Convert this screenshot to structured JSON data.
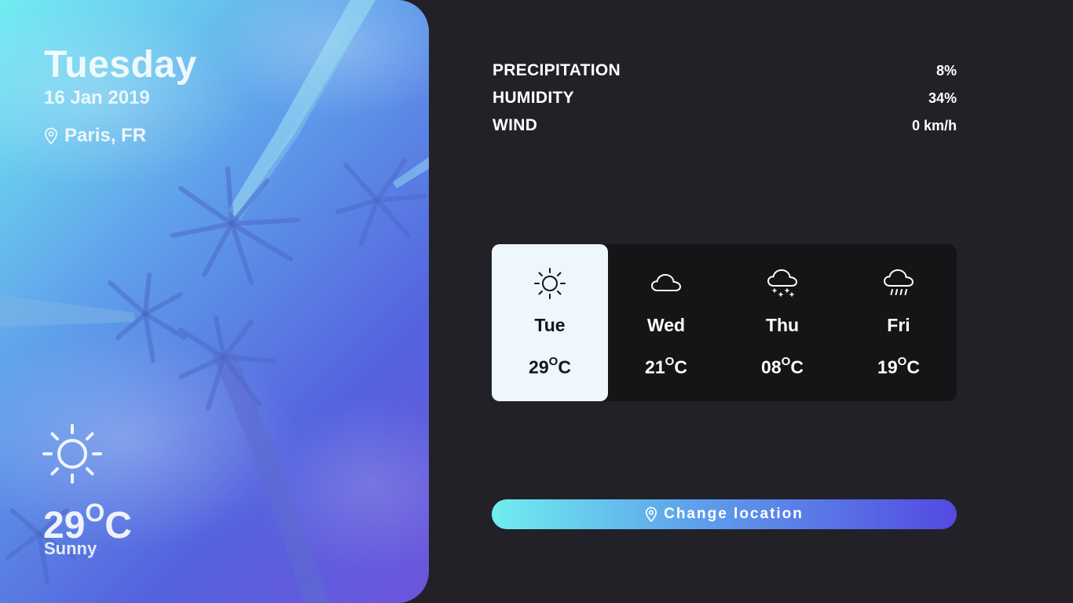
{
  "hero": {
    "day": "Tuesday",
    "date": "16 Jan 2019",
    "location": "Paris, FR",
    "temp_value": "29",
    "temp_degree": "O",
    "temp_unit": "C",
    "condition": "Sunny",
    "icon": "sun-icon",
    "location_icon": "map-pin-icon"
  },
  "stats": [
    {
      "label": "PRECIPITATION",
      "value": "8%"
    },
    {
      "label": "HUMIDITY",
      "value": "34%"
    },
    {
      "label": "WIND",
      "value": "0 km/h"
    }
  ],
  "forecast": [
    {
      "day": "Tue",
      "temp": "29",
      "degree": "O",
      "unit": "C",
      "icon": "sun-icon",
      "active": true
    },
    {
      "day": "Wed",
      "temp": "21",
      "degree": "O",
      "unit": "C",
      "icon": "cloud-icon",
      "active": false
    },
    {
      "day": "Thu",
      "temp": "08",
      "degree": "O",
      "unit": "C",
      "icon": "snow-cloud-icon",
      "active": false
    },
    {
      "day": "Fri",
      "temp": "19",
      "degree": "O",
      "unit": "C",
      "icon": "rain-cloud-icon",
      "active": false
    }
  ],
  "change_location": {
    "label": "Change location",
    "icon": "map-pin-icon"
  },
  "colors": {
    "background": "#222127",
    "forecast_panel": "#151517",
    "active_card": "#EEF6FE",
    "gradient_start": "#72EDF2",
    "gradient_end": "#5449E2"
  }
}
